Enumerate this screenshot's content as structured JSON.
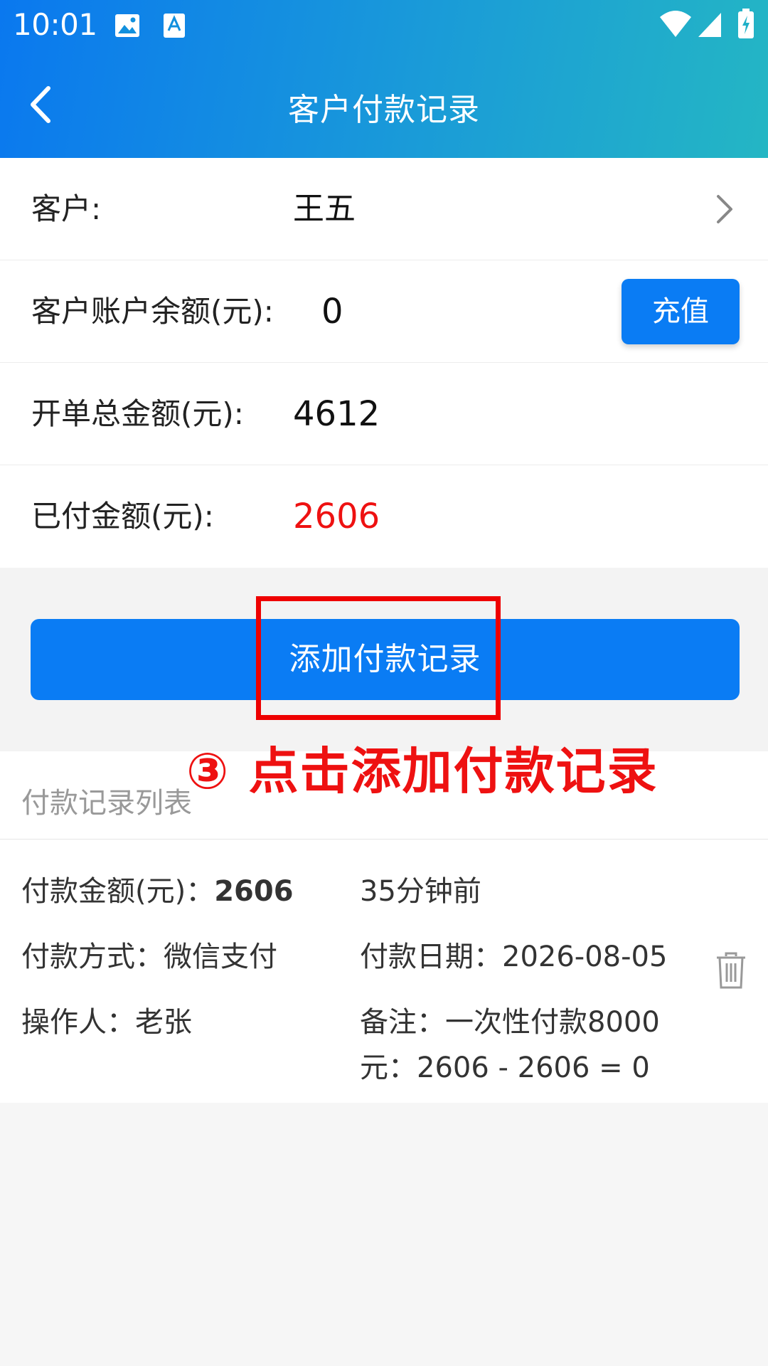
{
  "status_bar": {
    "time": "10:01"
  },
  "nav": {
    "title": "客户付款记录"
  },
  "info": {
    "customer_label": "客户:",
    "customer_value": "王五",
    "balance_label": "客户账户余额(元):",
    "balance_value": "0",
    "recharge_label": "充值",
    "total_label": "开单总金额(元):",
    "total_value": "4612",
    "paid_label": "已付金额(元):",
    "paid_value": "2606"
  },
  "actions": {
    "add_label": "添加付款记录"
  },
  "annotation": {
    "text": "③ 点击添加付款记录"
  },
  "list": {
    "title": "付款记录列表",
    "records": [
      {
        "amount_label": "付款金额(元)：",
        "amount_value": "2606",
        "time_ago": "35分钟前",
        "method": "付款方式：微信支付",
        "date": "付款日期：2026-08-05",
        "operator": "操作人：老张",
        "note_line1": "备注：一次性付款8000",
        "note_line2": "元：2606 - 2606 = 0"
      }
    ]
  },
  "colors": {
    "primary": "#0a7cf4",
    "header_start": "#0a78ef",
    "header_end": "#24b6c4",
    "highlight": "#ee1111"
  },
  "icons": {
    "back": "chevron-left-icon",
    "forward": "chevron-right-icon",
    "delete": "trash-icon",
    "gallery": "image-icon",
    "font": "font-icon",
    "wifi": "wifi-icon",
    "signal": "signal-icon",
    "battery": "battery-icon"
  }
}
